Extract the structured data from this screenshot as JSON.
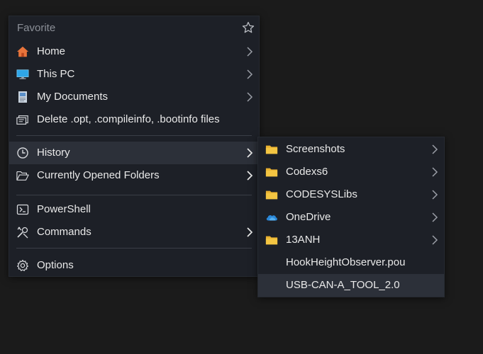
{
  "main_menu": {
    "header": "Favorite",
    "items": [
      {
        "label": "Home",
        "icon": "home-icon"
      },
      {
        "label": "This PC",
        "icon": "monitor-icon"
      },
      {
        "label": "My Documents",
        "icon": "documents-icon"
      },
      {
        "label": "Delete .opt, .compileinfo, .bootinfo files",
        "icon": "delete-files-icon"
      },
      {
        "label": "History",
        "icon": "clock-icon"
      },
      {
        "label": "Currently Opened Folders",
        "icon": "open-folder-icon"
      },
      {
        "label": "PowerShell",
        "icon": "powershell-icon"
      },
      {
        "label": "Commands",
        "icon": "tools-icon"
      },
      {
        "label": "Options",
        "icon": "gear-icon"
      }
    ]
  },
  "sub_menu": {
    "items": [
      {
        "label": "Screenshots",
        "icon": "folder-icon"
      },
      {
        "label": "Codexs6",
        "icon": "folder-icon"
      },
      {
        "label": "CODESYSLibs",
        "icon": "folder-icon"
      },
      {
        "label": "OneDrive",
        "icon": "onedrive-icon"
      },
      {
        "label": "13ANH",
        "icon": "folder-icon"
      },
      {
        "label": "HookHeightObserver.pou",
        "icon": ""
      },
      {
        "label": "USB-CAN-A_TOOL_2.0",
        "icon": ""
      }
    ]
  },
  "colors": {
    "menu_bg": "#1d2027",
    "highlight": "#2c3039",
    "folder_yellow": "#f4c542",
    "home_orange": "#e8743b",
    "monitor_blue": "#2fa6e8",
    "onedrive_blue": "#2b88d8"
  }
}
